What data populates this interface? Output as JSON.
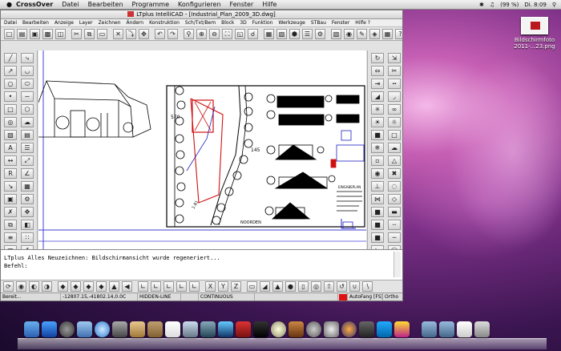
{
  "menubar": {
    "apple_icon": "apple-icon",
    "app_name": "CrossOver",
    "items": [
      "Datei",
      "Bearbeiten",
      "Programme",
      "Konfigurieren",
      "Fenster",
      "Hilfe"
    ],
    "battery": "(99 %)",
    "clock": "Di. 8:09"
  },
  "desktop": {
    "file_icon_label_line1": "Bildschirmfoto",
    "file_icon_label_line2": "2011-...23.png"
  },
  "window": {
    "title": "LTplus IntelliCAD - [Industrial_Plan_2009_3D.dwg]",
    "menu": [
      "Datei",
      "Bearbeiten",
      "Anzeige",
      "Layer",
      "Zeichnen",
      "Ändern",
      "Konstruktion",
      "Sch/Txt/Bem",
      "Block",
      "3D",
      "Funktion",
      "Werkzeuge",
      "STBau",
      "Fenster",
      "Hilfe ?"
    ]
  },
  "drawing": {
    "label_570": "570",
    "label_145": "145",
    "label_181": "1.81",
    "label_noord": "NOORDEN",
    "legend_title": "EINGABEPLAN"
  },
  "command": {
    "line1": "LTplus Alles Neuzeichnen: Bildschirmansicht wurde regeneriert...",
    "line2": "Befehl:"
  },
  "statusbar": {
    "ready": "Bereit...",
    "coords": "-12807.15,-41802.14,0.0C",
    "render": "HIDDEN-LINE",
    "linetype": "CONTINUOUS",
    "autofang": "AutoFang [FS]",
    "ortho": "Ortho"
  },
  "colors": {
    "accent_red": "#e01010",
    "desktop_pink": "#c65fb4"
  }
}
